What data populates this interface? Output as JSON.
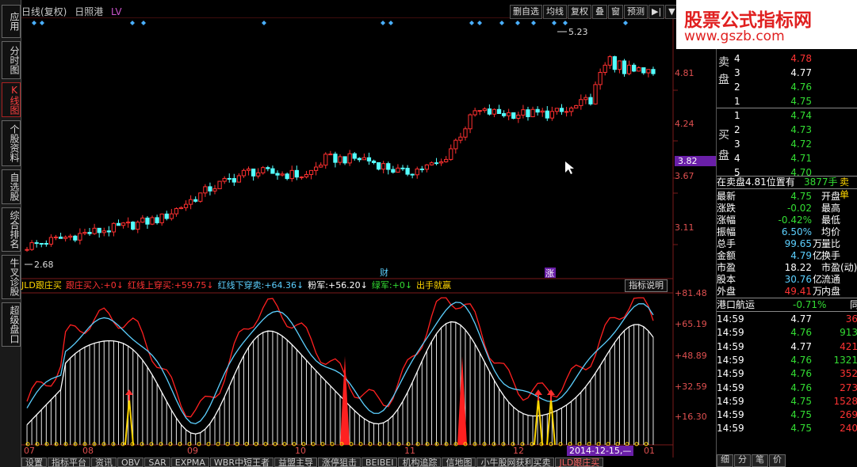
{
  "sidebar": {
    "items": [
      {
        "label": "应用",
        "active": false
      },
      {
        "label": "分时图",
        "active": false
      },
      {
        "label": "K线图",
        "active": true
      },
      {
        "label": "个股资料",
        "active": false
      },
      {
        "label": "自选股",
        "active": false
      },
      {
        "label": "综合排名",
        "active": false
      },
      {
        "label": "牛叉诊股",
        "active": false
      },
      {
        "label": "超级盘口",
        "active": false
      }
    ]
  },
  "title": {
    "period": "日线(复权)",
    "stock": "日照港",
    "lv": "LV"
  },
  "toolbar": [
    "删自选",
    "均线",
    "复权",
    "叠",
    "窗",
    "预测",
    "▶|",
    "▼"
  ],
  "logo": {
    "line1": "股票公式指标网",
    "line2": "www.gszb.com"
  },
  "main_chart": {
    "price_labels": [
      "4.81",
      "4.24",
      "3.82",
      "3.67",
      "3.11"
    ],
    "highlight_price": "3.82",
    "max_label": "5.23",
    "min_label": "2.68",
    "markers": [
      "财",
      "涨"
    ]
  },
  "indicator": {
    "name": "JLD跟庄买",
    "items": [
      {
        "label": "跟庄买入:",
        "value": "+0↓",
        "color": "#ff3333"
      },
      {
        "label": "红线上穿买:",
        "value": "+59.75↓",
        "color": "#ff3333"
      },
      {
        "label": "红线下穿卖:",
        "value": "+64.36↓",
        "color": "#5cd0ff"
      },
      {
        "label": "粉军:",
        "value": "+56.20↓",
        "color": "#ffffff"
      },
      {
        "label": "绿军:",
        "value": "+0↓",
        "color": "#33dd33"
      },
      {
        "label": "出手就赢",
        "value": "",
        "color": "#ffd700"
      }
    ],
    "help_button": "指标说明",
    "axis_labels": [
      "+81.48",
      "+65.19",
      "+48.89",
      "+32.59",
      "+16.30"
    ]
  },
  "x_axis": [
    "07",
    "08",
    "09",
    "10",
    "11",
    "12",
    "01"
  ],
  "x_highlight": "2014-12-15,—",
  "bottom_tabs": [
    "设置",
    "指标平台",
    "资讯",
    "OBV",
    "SAR",
    "EXPMA",
    "WBR中短王者",
    "益盟主导",
    "涨停狙击",
    "BEIBEI",
    "机构追踪",
    "信地图",
    "小牛股网获利买卖",
    "JLD跟庄买"
  ],
  "order_book": {
    "sell_label": "卖盘",
    "buy_label": "买盘",
    "sell": [
      {
        "n": "4",
        "p": "4.78",
        "c": "r"
      },
      {
        "n": "3",
        "p": "4.77",
        "c": "w"
      },
      {
        "n": "2",
        "p": "4.76",
        "c": "g"
      },
      {
        "n": "1",
        "p": "4.75",
        "c": "g"
      }
    ],
    "buy": [
      {
        "n": "1",
        "p": "4.74",
        "c": "g"
      },
      {
        "n": "2",
        "p": "4.73",
        "c": "g"
      },
      {
        "n": "3",
        "p": "4.72",
        "c": "g"
      },
      {
        "n": "4",
        "p": "4.71",
        "c": "g"
      },
      {
        "n": "5",
        "p": "4.70",
        "c": "g"
      }
    ]
  },
  "status_line": {
    "text": "在卖盘4.81位置有",
    "vol": "3877手",
    "tail": "卖单"
  },
  "quotes": [
    {
      "l": "最新",
      "v": "4.75",
      "vc": "g",
      "r": "开盘"
    },
    {
      "l": "涨跌",
      "v": "-0.02",
      "vc": "g",
      "r": "最高"
    },
    {
      "l": "涨幅",
      "v": "-0.42%",
      "vc": "g",
      "r": "最低"
    },
    {
      "l": "振幅",
      "v": "6.50%",
      "vc": "c",
      "r": "均价"
    },
    {
      "l": "总手",
      "v": "99.65",
      "vc": "c",
      "u": "万",
      "r": "量比"
    },
    {
      "l": "金额",
      "v": "4.79",
      "vc": "c",
      "u": "亿",
      "r": "换手"
    },
    {
      "l": "市盈",
      "v": "18.22",
      "vc": "w",
      "r": "市盈(动)"
    },
    {
      "l": "股本",
      "v": "30.76",
      "vc": "c",
      "u": "亿",
      "r": "流通"
    },
    {
      "l": "外盘",
      "v": "49.41",
      "vc": "r",
      "u": "万",
      "r": "内盘"
    }
  ],
  "sector": {
    "name": "港口航运",
    "chg": "-0.71%",
    "tail": "同"
  },
  "ticks": [
    {
      "t": "14:59",
      "p": "4.77",
      "pc": "w",
      "v": "36",
      "vc": "r"
    },
    {
      "t": "14:59",
      "p": "4.76",
      "pc": "g",
      "v": "913",
      "vc": "g"
    },
    {
      "t": "14:59",
      "p": "4.77",
      "pc": "w",
      "v": "421",
      "vc": "r"
    },
    {
      "t": "14:59",
      "p": "4.76",
      "pc": "g",
      "v": "1321",
      "vc": "g"
    },
    {
      "t": "14:59",
      "p": "4.76",
      "pc": "g",
      "v": "352",
      "vc": "r"
    },
    {
      "t": "14:59",
      "p": "4.76",
      "pc": "g",
      "v": "273",
      "vc": "r"
    },
    {
      "t": "14:59",
      "p": "4.75",
      "pc": "g",
      "v": "1528",
      "vc": "r"
    },
    {
      "t": "14:59",
      "p": "4.75",
      "pc": "g",
      "v": "269",
      "vc": "r"
    },
    {
      "t": "14:59",
      "p": "4.75",
      "pc": "g",
      "v": "240",
      "vc": "r"
    }
  ],
  "bottom_right": [
    "细",
    "分",
    "笔",
    "价"
  ]
}
